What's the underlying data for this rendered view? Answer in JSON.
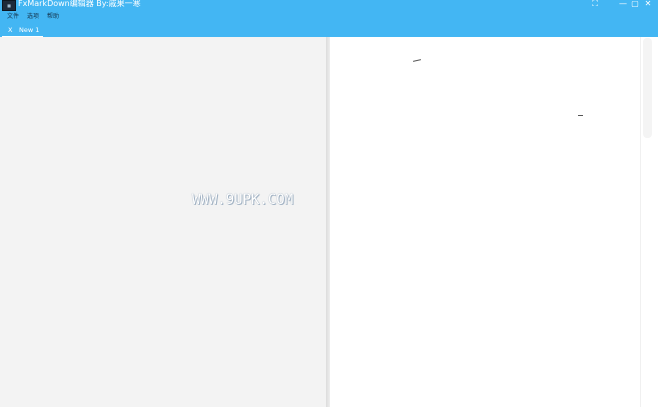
{
  "window": {
    "title": "FxMarkDown编辑器  By:戚果一寒",
    "icon": "app-logo-icon",
    "controls": {
      "fullscreen_icon": "⛶",
      "minimize_icon": "—",
      "maximize_icon": "▢",
      "close_icon": "✕"
    }
  },
  "menu": {
    "items": [
      {
        "label": "文件"
      },
      {
        "label": "选项"
      },
      {
        "label": "帮助"
      }
    ]
  },
  "tabs": [
    {
      "close_icon": "X",
      "label": "New 1"
    }
  ],
  "watermark": "WWW.9UPK.COM",
  "colors": {
    "titlebar": "#43b6f3",
    "editor_background": "#f3f3f3",
    "preview_background": "#ffffff"
  }
}
